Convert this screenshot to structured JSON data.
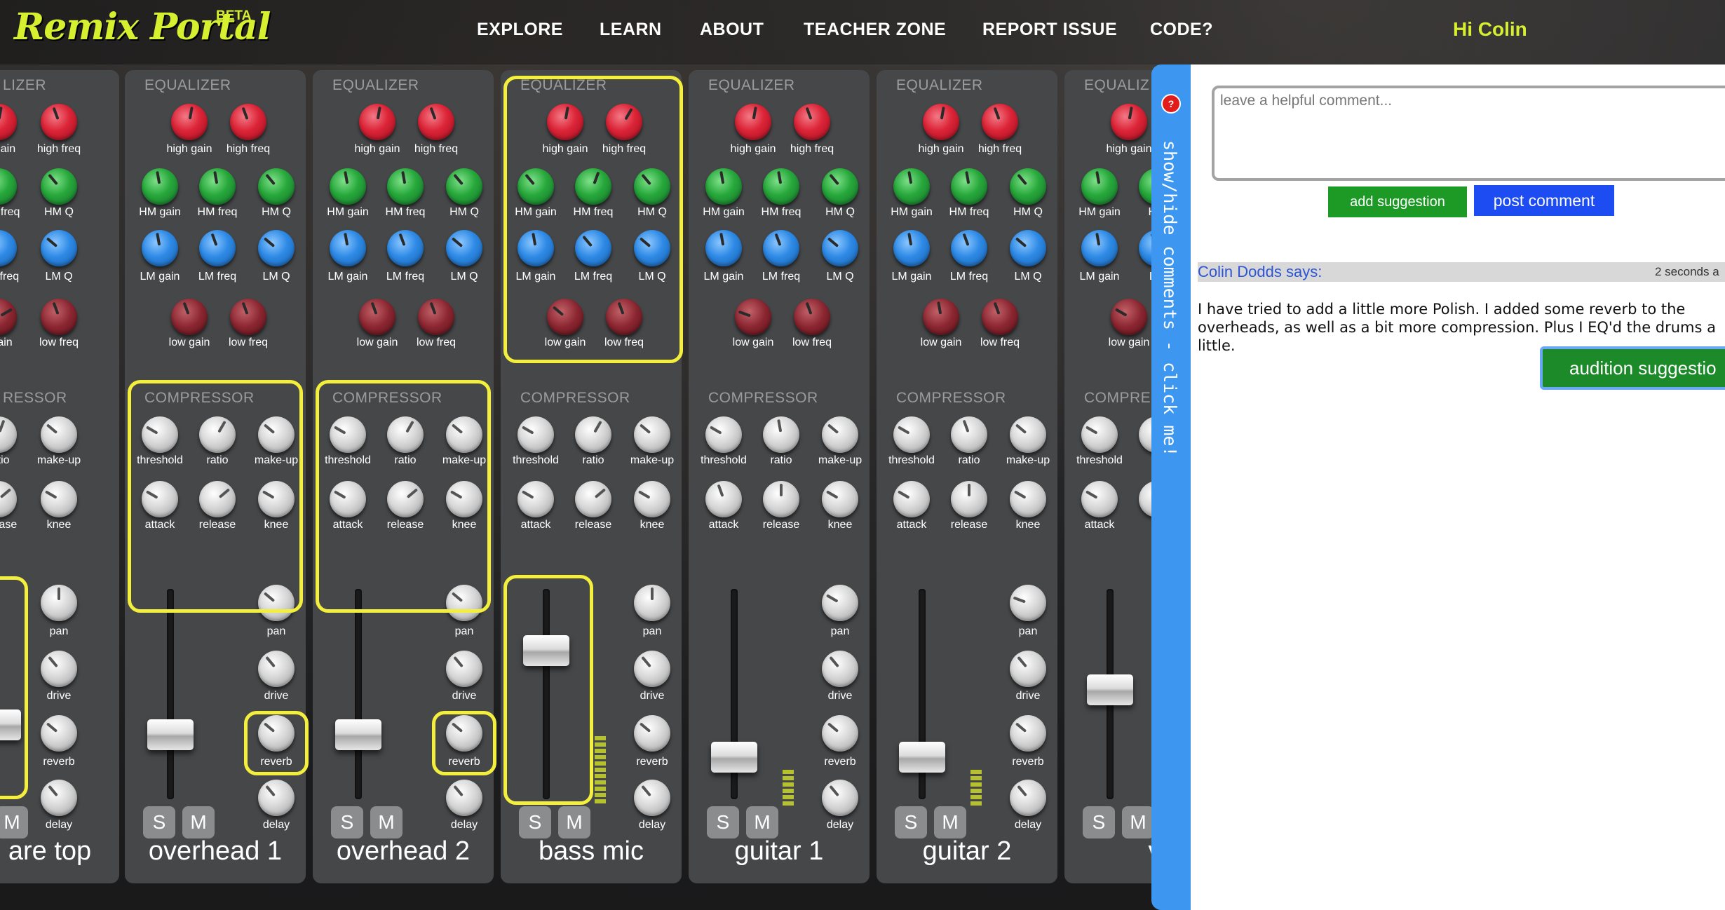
{
  "nav": {
    "logo": "Remix Portal",
    "beta": "BETA",
    "links": [
      "EXPLORE",
      "LEARN",
      "ABOUT",
      "TEACHER ZONE",
      "REPORT ISSUE",
      "CODE?"
    ],
    "greeting": "Hi Colin"
  },
  "mixer": {
    "eq_title": "EQUALIZER",
    "comp_title": "COMPRESSOR",
    "partial_eq_title": "LIZER",
    "partial_comp_title": "RESSOR",
    "partial_eq_title_right": "EQUALIZ",
    "partial_comp_title_right": "COMPRES",
    "eq_labels": {
      "high_gain": "high gain",
      "high_freq": "high freq",
      "hm_gain": "HM gain",
      "hm_freq": "HM freq",
      "hm_q": "HM Q",
      "lm_gain": "LM gain",
      "lm_freq": "LM freq",
      "lm_q": "LM Q",
      "low_gain": "low gain",
      "low_freq": "low freq"
    },
    "comp_labels": {
      "threshold": "threshold",
      "ratio": "ratio",
      "makeup": "make-up",
      "attack": "attack",
      "release": "release",
      "knee": "knee"
    },
    "strip_labels": {
      "pan": "pan",
      "drive": "drive",
      "reverb": "reverb",
      "delay": "delay"
    },
    "partial_labels": {
      "gain": "gain",
      "ain": "ain",
      "hm": "HM",
      "lm": "LM",
      "re": "r",
      "rel": "rel"
    },
    "solo": "S",
    "mute": "M",
    "channels": [
      "are top",
      "overhead 1",
      "overhead 2",
      "bass mic",
      "guitar 1",
      "guitar 2",
      "v"
    ]
  },
  "comments": {
    "tab_label": "show/hide comments - click me!",
    "help_badge": "?",
    "input_placeholder": "leave a helpful comment...",
    "add_suggestion": "add suggestion",
    "post_comment": "post comment",
    "author": "Colin Dodds says:",
    "time": "2 seconds a",
    "body": "I have tried to add a little more Polish. I added some reverb to the overheads, as well as a bit more compression. Plus I EQ'd the drums a little.",
    "audition": "audition suggestio"
  },
  "colors": {
    "brand": "#d6ef2f",
    "highlight": "#f4ef3c",
    "panel_tab": "#3d97f0",
    "add_button": "#1d9a26",
    "post_button": "#1d4cf2"
  }
}
